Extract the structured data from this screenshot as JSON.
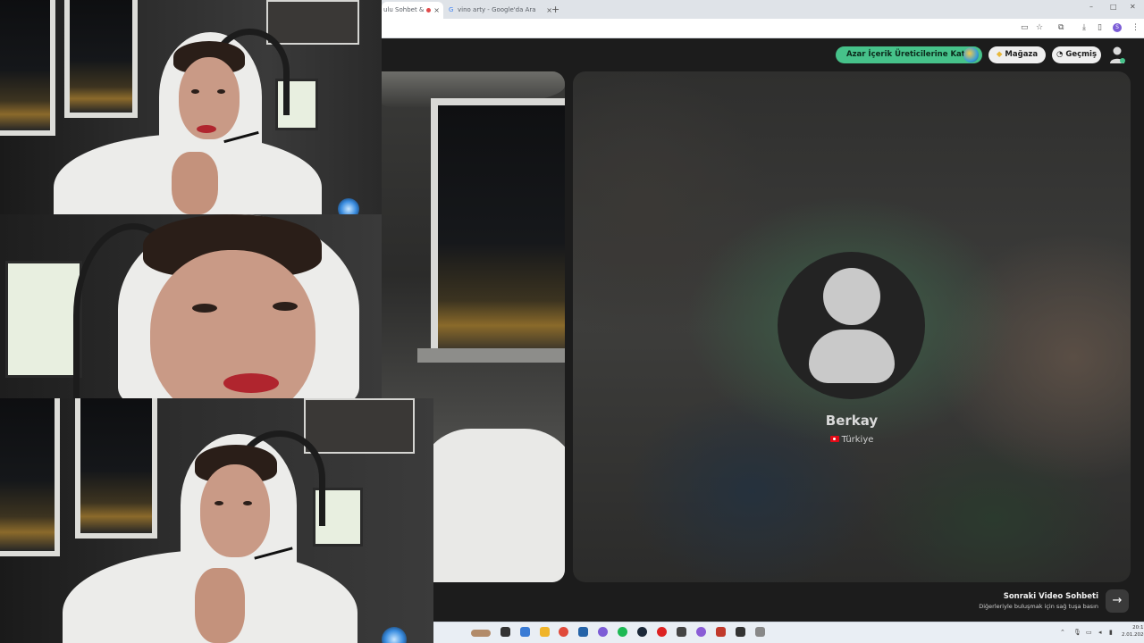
{
  "browser": {
    "tabs": [
      {
        "label": "ulu Sohbet &",
        "active": true,
        "recording": true
      },
      {
        "label": "vino arty - Google'da Ara",
        "active": false
      }
    ],
    "new_tab_glyph": "+",
    "close_glyph": "×",
    "window_controls": [
      "–",
      "□",
      "✕"
    ],
    "profile_initial": "S"
  },
  "app": {
    "buttons": {
      "creator": "Azar İçerik Üreticilerine Katıl",
      "store": "Mağaza",
      "history": "Geçmiş"
    },
    "icons": {
      "store": "gem-icon",
      "history": "clock-icon",
      "profile": "user-icon",
      "next": "arrow-right-icon"
    },
    "remote_user": {
      "name": "Berkay",
      "country": "Türkiye"
    },
    "next_chat": {
      "title": "Sonraki Video Sohbeti",
      "subtitle": "Diğerleriyle buluşmak için sağ tuşa basın",
      "arrow": "→"
    }
  },
  "taskbar": {
    "clock_time": "20:17",
    "clock_date": "2.01.2026"
  },
  "colors": {
    "accent_green": "#46c28a",
    "app_background": "#1c1c1c",
    "flag_red": "#e30a17"
  }
}
